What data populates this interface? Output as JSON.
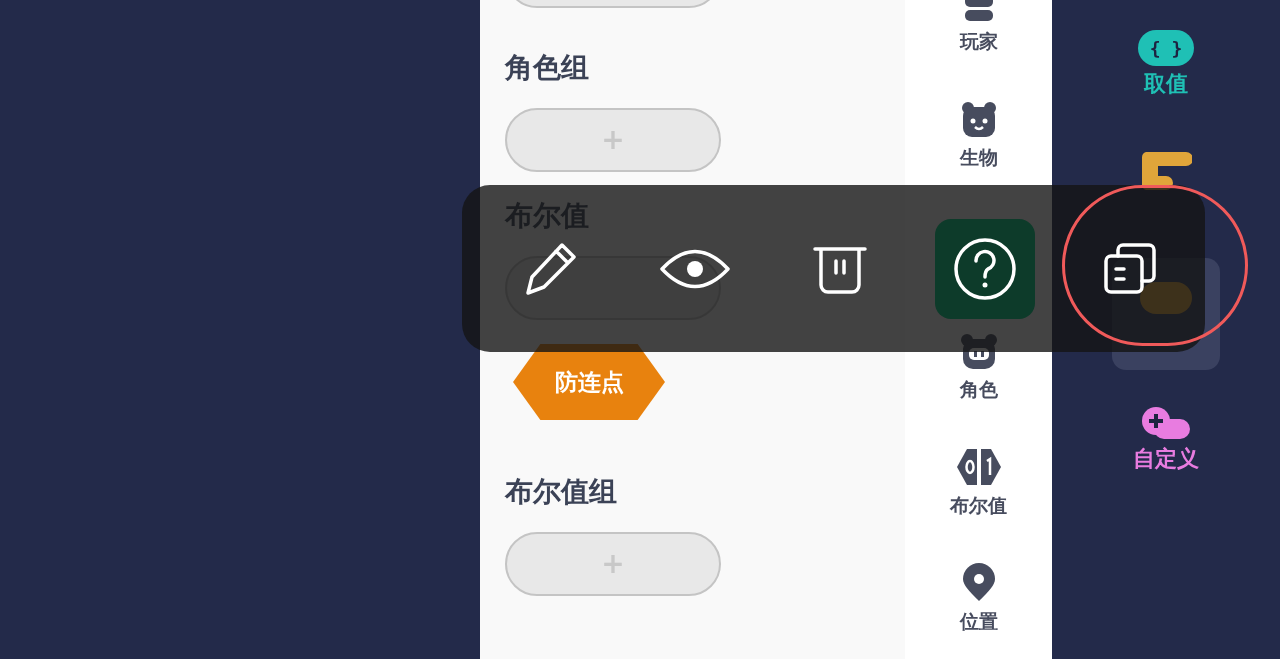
{
  "palette": {
    "items": [
      {
        "kind": "add_button"
      },
      {
        "kind": "heading",
        "label": "角色组"
      },
      {
        "kind": "add_button",
        "label": "+"
      },
      {
        "kind": "heading",
        "label": "布尔值"
      },
      {
        "kind": "add_button"
      },
      {
        "kind": "block",
        "label": "防连点"
      },
      {
        "kind": "heading",
        "label": "布尔值组"
      },
      {
        "kind": "add_button",
        "label": "+"
      }
    ]
  },
  "categories": [
    {
      "label": "玩家"
    },
    {
      "label": "生物"
    },
    {
      "label": "角色"
    },
    {
      "label": "布尔值"
    },
    {
      "label": "位置"
    }
  ],
  "groups": [
    {
      "glyph": "{ }",
      "label": "取值",
      "color": "#1fc0b5",
      "selected": false
    },
    {
      "color": "#e0a53a",
      "selected": false
    },
    {
      "selected": true
    },
    {
      "label": "自定义",
      "color": "#e87ce0",
      "selected": false
    }
  ],
  "toolbar": {
    "buttons": [
      {
        "kind": "edit",
        "highlighted": false
      },
      {
        "kind": "view",
        "highlighted": false
      },
      {
        "kind": "delete",
        "highlighted": false
      },
      {
        "kind": "help",
        "highlighted": true
      },
      {
        "kind": "copy",
        "highlighted": false
      }
    ]
  }
}
